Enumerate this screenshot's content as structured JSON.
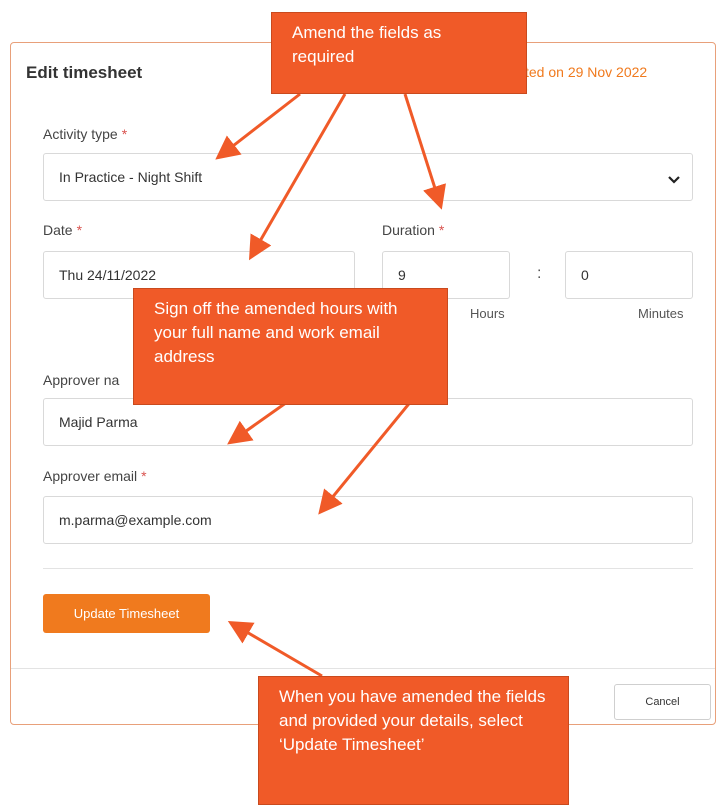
{
  "dialog": {
    "title": "Edit timesheet",
    "submitted_text": "itted on 29 Nov 2022"
  },
  "form": {
    "activity_type": {
      "label": "Activity type",
      "required_mark": "*",
      "value": "In Practice - Night Shift"
    },
    "date": {
      "label": "Date",
      "required_mark": "*",
      "value": "Thu 24/11/2022"
    },
    "duration": {
      "label": "Duration",
      "required_mark": "*",
      "hours_value": "9",
      "minutes_value": "0",
      "separator": ":",
      "hours_unit": "Hours",
      "minutes_unit": "Minutes"
    },
    "approver_name": {
      "label": "Approver na",
      "value": "Majid Parma"
    },
    "approver_email": {
      "label": "Approver email",
      "required_mark": "*",
      "value": "m.parma@example.com"
    }
  },
  "actions": {
    "update_label": "Update Timesheet",
    "cancel_label": "Cancel"
  },
  "callouts": {
    "top": "Amend the fields as required",
    "middle": "Sign off the amended hours with your full name and work email address",
    "bottom": "When you have amended the fields and provided your details, select ‘Update Timesheet’"
  },
  "colors": {
    "accent": "#f07a1e",
    "callout": "#f05a28",
    "required": "#d9534f"
  }
}
